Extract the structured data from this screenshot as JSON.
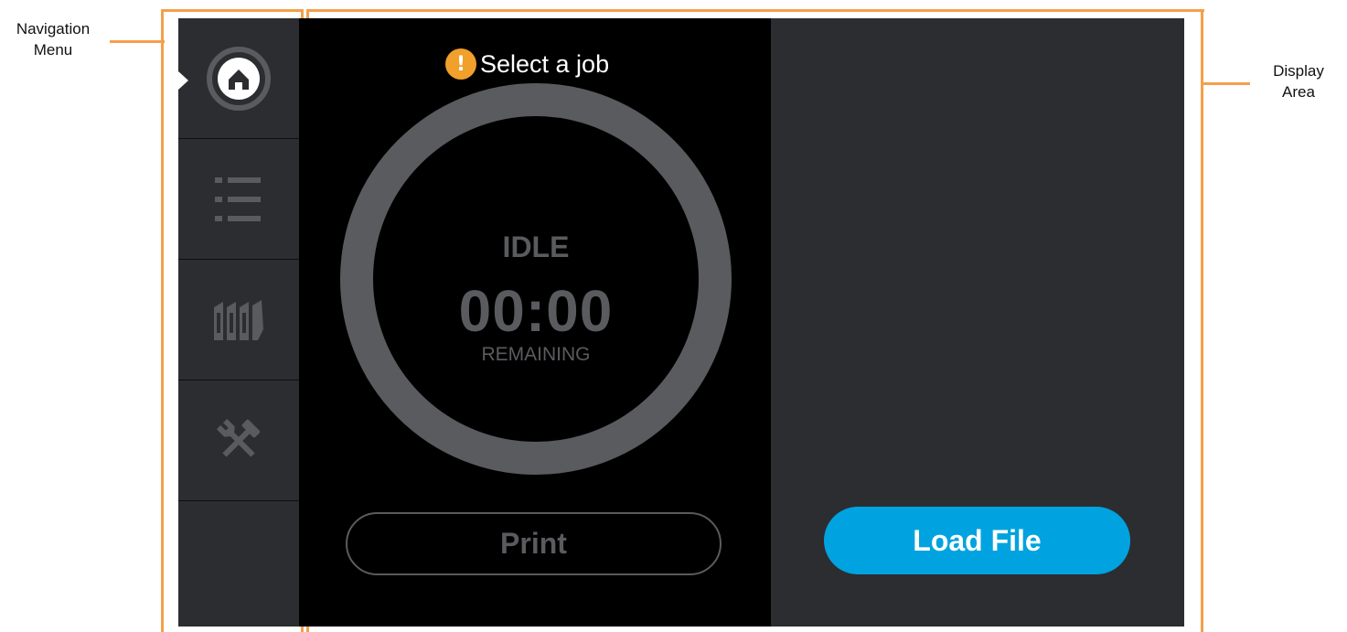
{
  "annotations": {
    "navigation_menu": "Navigation\nMenu",
    "display_area": "Display\nArea",
    "color": "#F4A04A"
  },
  "nav": {
    "items": [
      {
        "name": "home",
        "icon": "home-icon",
        "active": true
      },
      {
        "name": "jobs-list",
        "icon": "list-icon",
        "active": false
      },
      {
        "name": "materials",
        "icon": "material-bays-icon",
        "active": false
      },
      {
        "name": "tools",
        "icon": "tools-icon",
        "active": false
      }
    ]
  },
  "status": {
    "icon": "warning-icon",
    "text": "Select a job"
  },
  "job": {
    "state": "IDLE",
    "time": "00:00",
    "remaining_label": "REMAINING",
    "progress": 0
  },
  "buttons": {
    "print_label": "Print",
    "load_file_label": "Load File"
  },
  "colors": {
    "accent": "#00A3E0",
    "warning": "#F0A02B",
    "panel": "#2C2D30",
    "disabled": "#5A5B5F"
  }
}
